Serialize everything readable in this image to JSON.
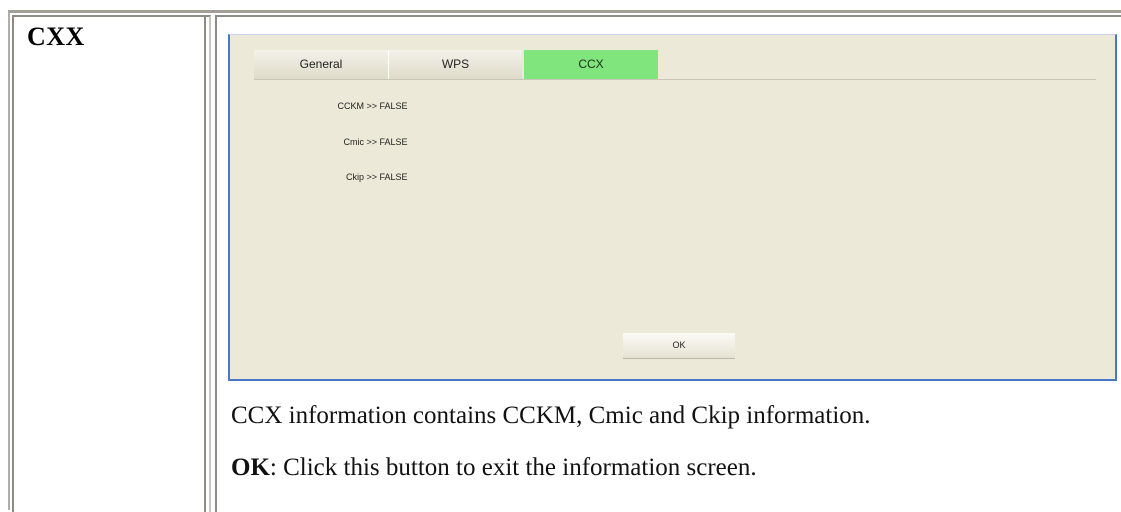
{
  "section": {
    "title": "CXX"
  },
  "dialog": {
    "tabs": [
      {
        "label": "General"
      },
      {
        "label": "WPS"
      },
      {
        "label": "CCX"
      }
    ],
    "active_tab": "CCX",
    "active_tab_color": "#80e57c",
    "rows": [
      {
        "label": "CCKM",
        "sep": ">>",
        "value": "FALSE"
      },
      {
        "label": "Cmic",
        "sep": ">>",
        "value": "FALSE"
      },
      {
        "label": "Ckip",
        "sep": ">>",
        "value": "FALSE"
      }
    ],
    "ok_label": "OK"
  },
  "description": {
    "line1": "CCX information contains CCKM, Cmic and Ckip information.",
    "ok_term": "OK",
    "ok_text": ": Click this button to exit the information screen."
  }
}
